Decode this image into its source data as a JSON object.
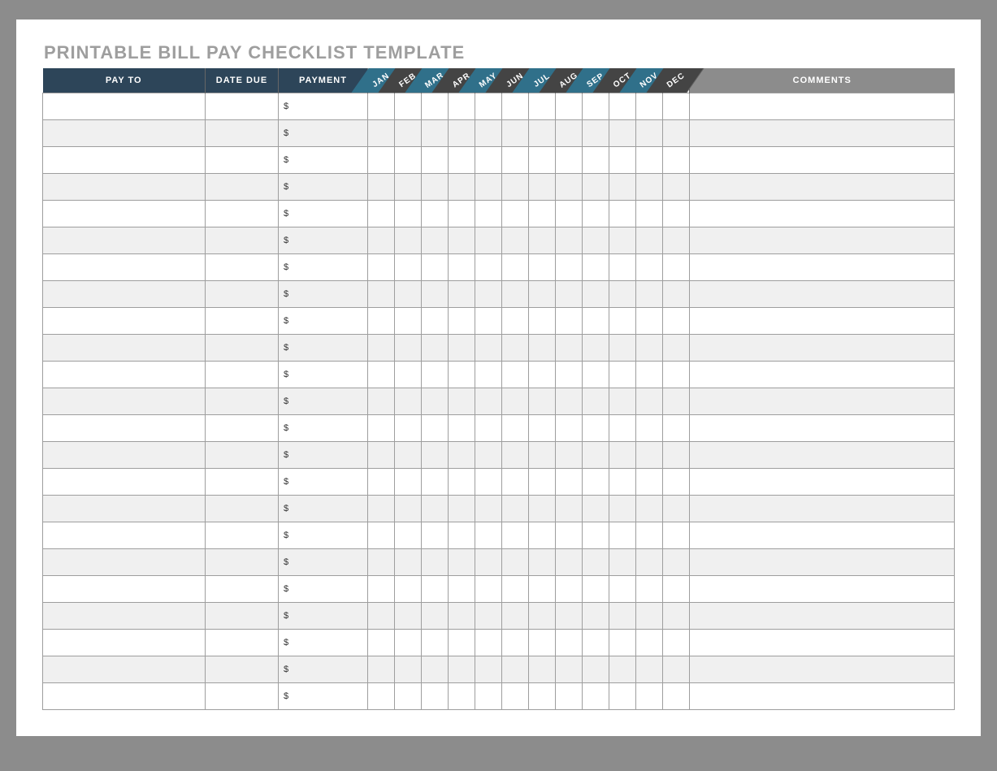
{
  "title": "PRINTABLE BILL PAY CHECKLIST TEMPLATE",
  "columns": {
    "pay_to": "PAY TO",
    "date_due": "DATE DUE",
    "payment": "PAYMENT",
    "comments": "COMMENTS"
  },
  "months": [
    "JAN",
    "FEB",
    "MAR",
    "APR",
    "MAY",
    "JUN",
    "JUL",
    "AUG",
    "SEP",
    "OCT",
    "NOV",
    "DEC"
  ],
  "month_tab_colors": [
    "#30708a",
    "#444444",
    "#30708a",
    "#444444",
    "#30708a",
    "#444444",
    "#30708a",
    "#444444",
    "#30708a",
    "#444444",
    "#30708a",
    "#444444"
  ],
  "currency_symbol": "$",
  "row_count": 23,
  "rows": [
    {
      "pay_to": "",
      "date_due": "",
      "payment": "",
      "comments": ""
    },
    {
      "pay_to": "",
      "date_due": "",
      "payment": "",
      "comments": ""
    },
    {
      "pay_to": "",
      "date_due": "",
      "payment": "",
      "comments": ""
    },
    {
      "pay_to": "",
      "date_due": "",
      "payment": "",
      "comments": ""
    },
    {
      "pay_to": "",
      "date_due": "",
      "payment": "",
      "comments": ""
    },
    {
      "pay_to": "",
      "date_due": "",
      "payment": "",
      "comments": ""
    },
    {
      "pay_to": "",
      "date_due": "",
      "payment": "",
      "comments": ""
    },
    {
      "pay_to": "",
      "date_due": "",
      "payment": "",
      "comments": ""
    },
    {
      "pay_to": "",
      "date_due": "",
      "payment": "",
      "comments": ""
    },
    {
      "pay_to": "",
      "date_due": "",
      "payment": "",
      "comments": ""
    },
    {
      "pay_to": "",
      "date_due": "",
      "payment": "",
      "comments": ""
    },
    {
      "pay_to": "",
      "date_due": "",
      "payment": "",
      "comments": ""
    },
    {
      "pay_to": "",
      "date_due": "",
      "payment": "",
      "comments": ""
    },
    {
      "pay_to": "",
      "date_due": "",
      "payment": "",
      "comments": ""
    },
    {
      "pay_to": "",
      "date_due": "",
      "payment": "",
      "comments": ""
    },
    {
      "pay_to": "",
      "date_due": "",
      "payment": "",
      "comments": ""
    },
    {
      "pay_to": "",
      "date_due": "",
      "payment": "",
      "comments": ""
    },
    {
      "pay_to": "",
      "date_due": "",
      "payment": "",
      "comments": ""
    },
    {
      "pay_to": "",
      "date_due": "",
      "payment": "",
      "comments": ""
    },
    {
      "pay_to": "",
      "date_due": "",
      "payment": "",
      "comments": ""
    },
    {
      "pay_to": "",
      "date_due": "",
      "payment": "",
      "comments": ""
    },
    {
      "pay_to": "",
      "date_due": "",
      "payment": "",
      "comments": ""
    },
    {
      "pay_to": "",
      "date_due": "",
      "payment": "",
      "comments": ""
    }
  ]
}
